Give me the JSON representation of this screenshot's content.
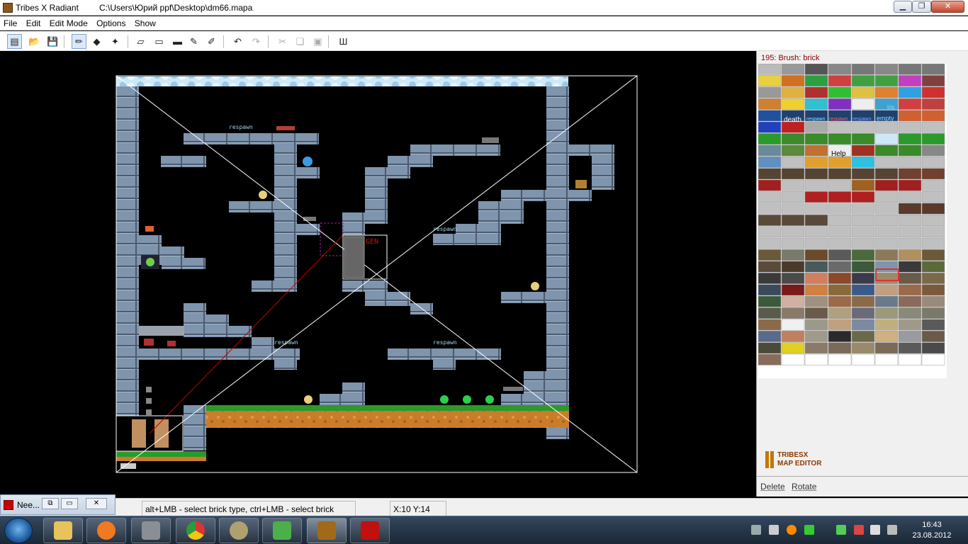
{
  "window": {
    "title": "Tribes X Radiant",
    "path": "C:\\Users\\Юрий ppf\\Desktop\\dm66.mapa",
    "minimize_glyph": "▁",
    "maximize_glyph": "❐",
    "close_glyph": "✕"
  },
  "menu": [
    "File",
    "Edit",
    "Edit Mode",
    "Options",
    "Show"
  ],
  "toolbar": {
    "buttons": [
      {
        "name": "new-map-button",
        "glyph": "▤",
        "active": true
      },
      {
        "name": "open-button",
        "glyph": "📂"
      },
      {
        "name": "save-button",
        "glyph": "💾"
      },
      {
        "name": "draw-pencil-button",
        "glyph": "✏",
        "active": true
      },
      {
        "name": "select-objects-button",
        "glyph": "◆"
      },
      {
        "name": "wand-button",
        "glyph": "✦"
      },
      {
        "name": "eraser-button",
        "glyph": "▱"
      },
      {
        "name": "rectangle-button",
        "glyph": "▭"
      },
      {
        "name": "filled-rectangle-button",
        "glyph": "▬"
      },
      {
        "name": "paint-button",
        "glyph": "✎"
      },
      {
        "name": "paint-special-button",
        "glyph": "✐"
      },
      {
        "name": "undo-button",
        "glyph": "↶"
      },
      {
        "name": "redo-button",
        "glyph": "↷",
        "disabled": true
      },
      {
        "name": "cut-button",
        "glyph": "✂",
        "disabled": true
      },
      {
        "name": "copy-button",
        "glyph": "❏",
        "disabled": true
      },
      {
        "name": "paste-button",
        "glyph": "▣",
        "disabled": true
      },
      {
        "name": "properties-button",
        "glyph": "Ш"
      }
    ]
  },
  "map": {
    "labels": {
      "respawn_1": "respawn",
      "respawn_2": "respawn",
      "respawn_3": "respawn",
      "respawn_4": "respawn",
      "gen": "GEN"
    }
  },
  "panel": {
    "brush_label": "195: Brush: brick",
    "palette_text": {
      "death": "death",
      "respawn_a": "respawn",
      "respawn_b": "respawn",
      "respawn_c": "respawn",
      "empty": "empty",
      "help": "Help",
      "trix": "trix"
    },
    "logo_line1": "TRIBESX",
    "logo_line2": "MAP EDITOR",
    "delete_label": "Delete",
    "rotate_label": "Rotate"
  },
  "statusbar": {
    "hint": "alt+LMB - select brick type, ctrl+LMB - select brick array",
    "coords": "X:10 Y:14"
  },
  "minimized_window": {
    "label": "Nee...",
    "restore_glyph": "⧉",
    "max_glyph": "▭",
    "close_glyph": "✕"
  },
  "taskbar": {
    "time": "16:43",
    "date": "23.08.2012"
  },
  "colors": {
    "brick": "#7f94ad",
    "brick_edge": "#4c5a6e",
    "ice": "#b9dcf2",
    "grass": "#2a9a2a",
    "dirt": "#c97d2a",
    "respawn_text": "#9fd6ee",
    "selection": "#ffffff",
    "red_line": "#c00000"
  }
}
